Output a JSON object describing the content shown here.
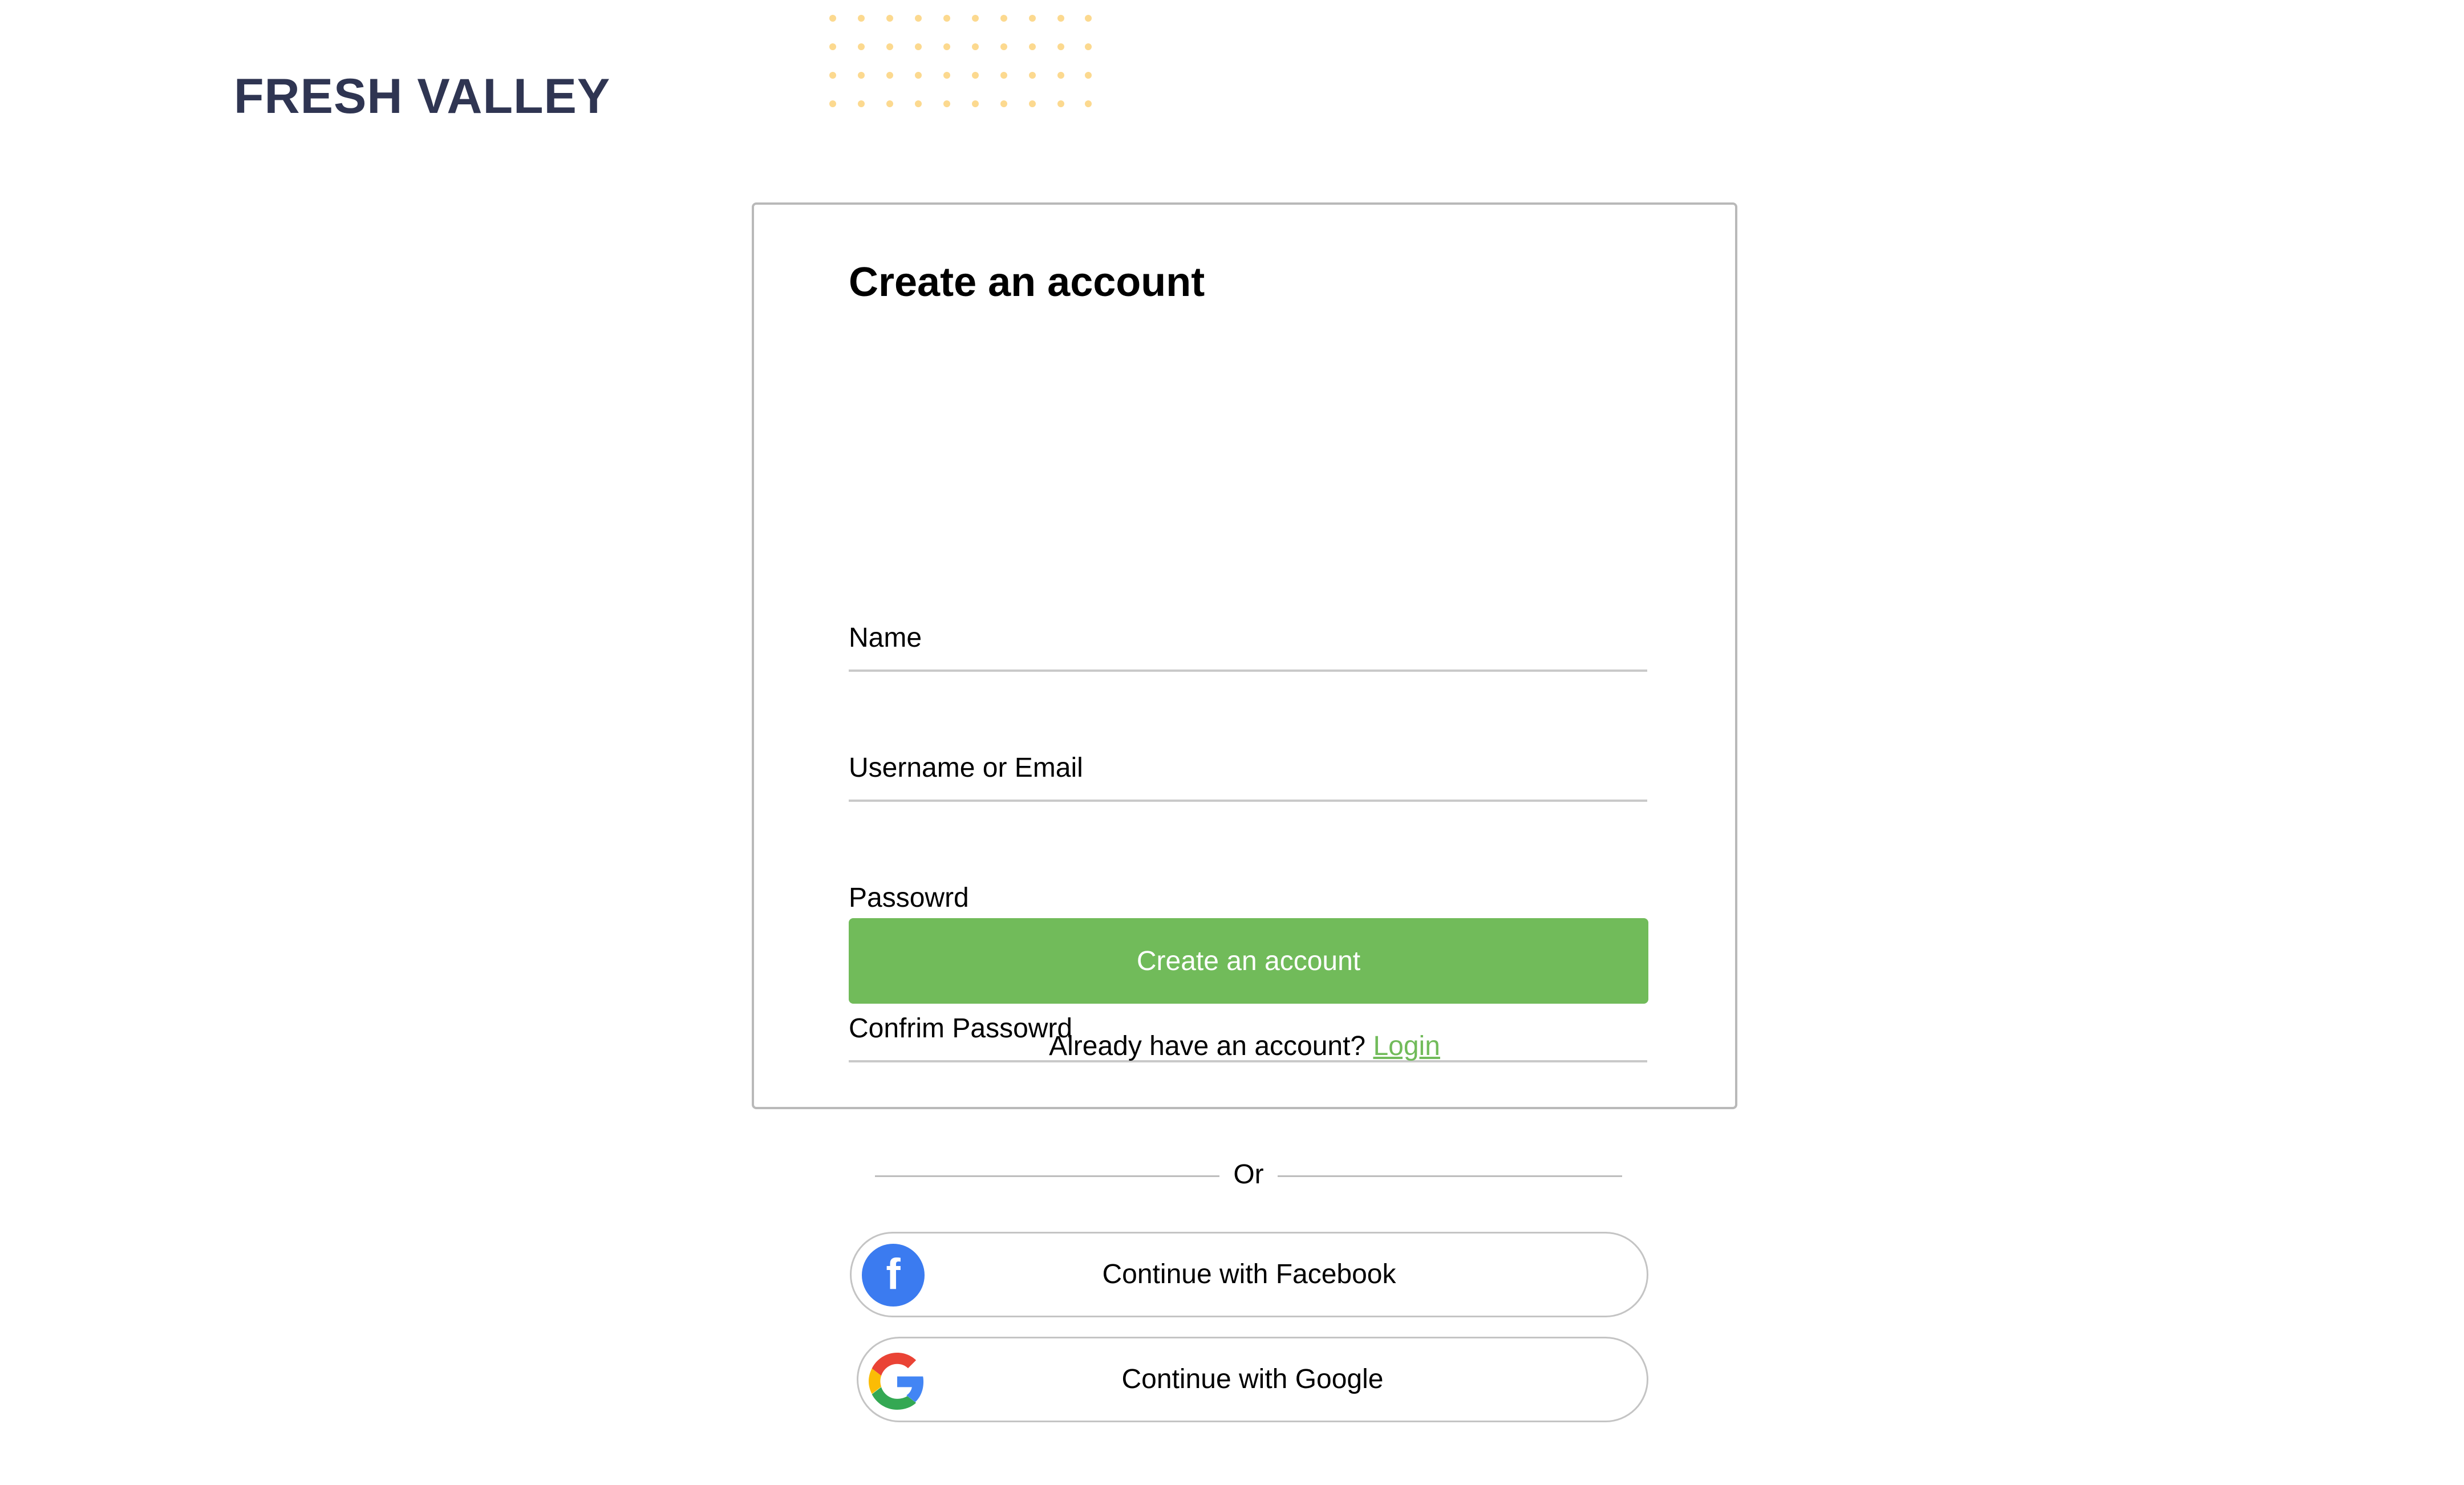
{
  "brand": {
    "name": "FRESH VALLEY"
  },
  "form": {
    "title": "Create an account",
    "fields": [
      {
        "placeholder": "Name"
      },
      {
        "placeholder": "Username or Email"
      },
      {
        "placeholder": "Passowrd"
      },
      {
        "placeholder": "Confrim Passowrd"
      }
    ],
    "submit_label": "Create an account",
    "login_prompt": "Already have an account?",
    "login_link": "Login"
  },
  "divider": {
    "text": "Or"
  },
  "social": {
    "facebook_label": "Continue with Facebook",
    "facebook_icon": "facebook-icon",
    "google_label": "Continue with Google",
    "google_icon": "google-icon"
  },
  "colors": {
    "brand_text": "#2f3552",
    "accent_green": "#71bb5a",
    "facebook_blue": "#3b7bf0",
    "decor_dots": "#fcd98f"
  }
}
